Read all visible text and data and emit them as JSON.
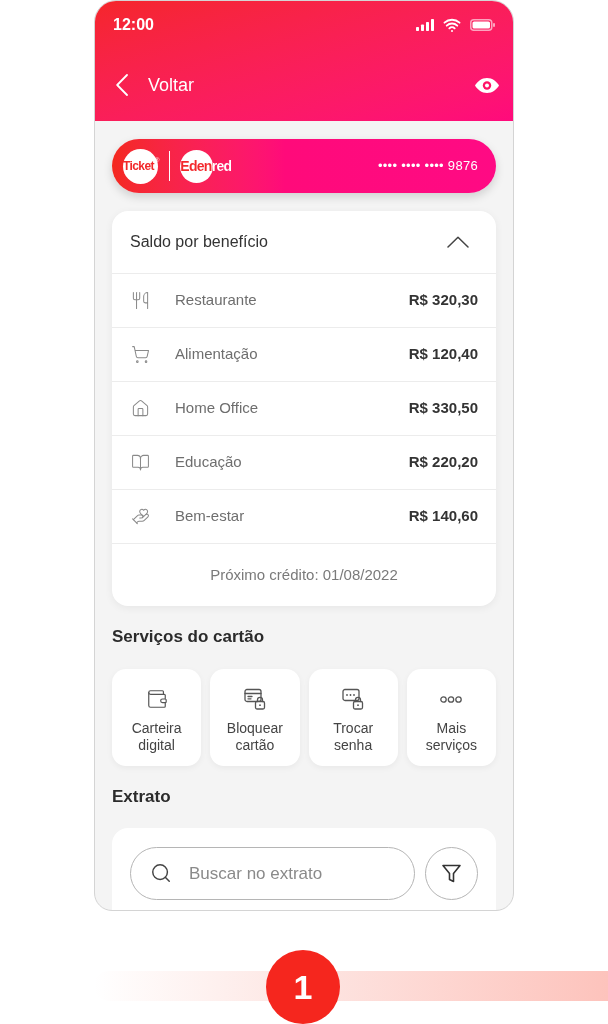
{
  "status_bar": {
    "time": "12:00"
  },
  "nav": {
    "back_label": "Voltar"
  },
  "card": {
    "logos": [
      {
        "kind": "ticket",
        "text": "Ticket",
        "mark": "®"
      },
      {
        "kind": "edenred",
        "text": "Edenred"
      }
    ],
    "number": "•••• •••• •••• 9876"
  },
  "benefits": {
    "title": "Saldo por benefício",
    "expanded": true,
    "items": [
      {
        "kind": "restaurant",
        "name": "Restaurante",
        "amount": "R$ 320,30"
      },
      {
        "kind": "grocery",
        "name": "Alimentação",
        "amount": "R$ 120,40"
      },
      {
        "kind": "home_office",
        "name": "Home Office",
        "amount": "R$ 330,50"
      },
      {
        "kind": "education",
        "name": "Educação",
        "amount": "R$ 220,20"
      },
      {
        "kind": "wellness",
        "name": "Bem-estar",
        "amount": "R$ 140,60"
      }
    ],
    "next_credit": "Próximo crédito: 01/08/2022"
  },
  "services": {
    "title": "Serviços do cartão",
    "items": [
      {
        "kind": "wallet",
        "label": "Carteira digital"
      },
      {
        "kind": "card_lock",
        "label": "Bloquear cartão"
      },
      {
        "kind": "password_lock",
        "label": "Trocar senha"
      },
      {
        "kind": "more",
        "label": "Mais serviços"
      }
    ]
  },
  "statement": {
    "title": "Extrato",
    "search": {
      "placeholder": "Buscar no extrato"
    }
  },
  "step": {
    "number": "1"
  }
}
